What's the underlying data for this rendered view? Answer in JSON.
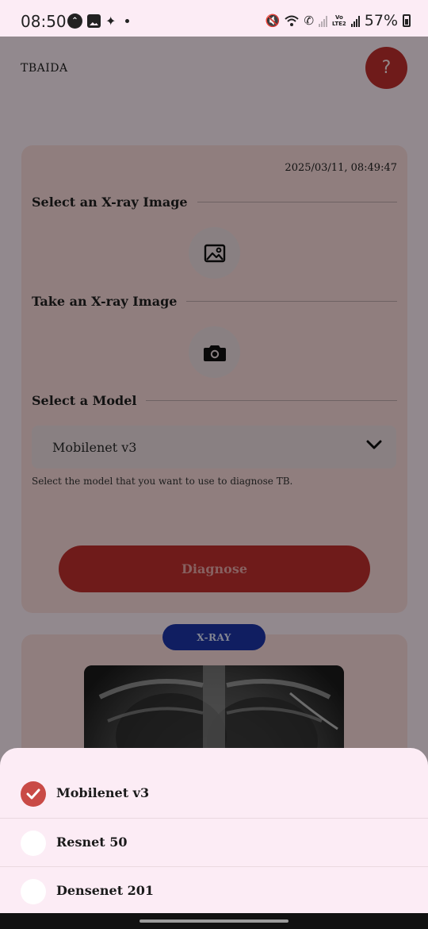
{
  "status_bar": {
    "time": "08:50",
    "battery": "57%",
    "lte_top": "Vo",
    "lte_bottom": "LTE2",
    "icons": [
      "app-notification-icon",
      "gallery-icon",
      "magic-wand-icon",
      "dot-icon",
      "vibrate-icon",
      "wifi-icon",
      "wifi-call-icon",
      "signal-icon",
      "battery-icon"
    ]
  },
  "app": {
    "title": "TBAIDA",
    "help_label": "?",
    "timestamp": "2025/03/11, 08:49:47",
    "section_select_image": "Select an X-ray Image",
    "section_take_image": "Take an X-ray Image",
    "section_model": "Select a Model",
    "model_selected": "Mobilenet v3",
    "helper": "Select the model that you want to use to diagnose TB.",
    "diagnose_label": "Diagnose",
    "xray_badge": "X-RAY"
  },
  "sheet": {
    "options": [
      {
        "label": "Mobilenet v3",
        "checked": true
      },
      {
        "label": "Resnet 50",
        "checked": false
      },
      {
        "label": "Densenet 201",
        "checked": false
      }
    ]
  },
  "colors": {
    "accent_red": "#c0302e",
    "badge_blue": "#1c34a8",
    "card_bg": "#f9dada",
    "sheet_bg": "#fcecf5"
  }
}
